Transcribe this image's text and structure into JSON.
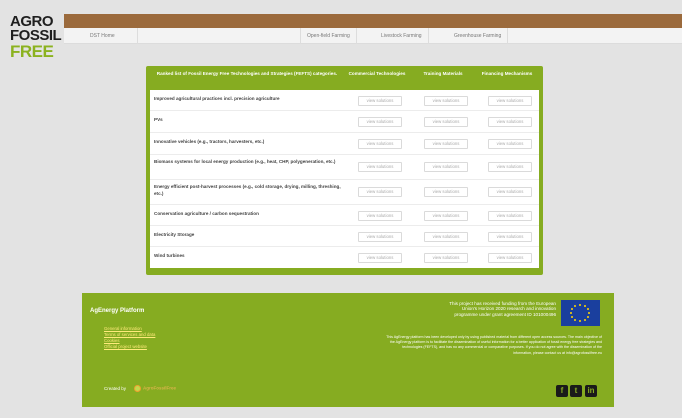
{
  "logo": {
    "line1": "AGRO",
    "line2": "FOSSIL",
    "line3": "FREE"
  },
  "nav": {
    "home": "DST Home",
    "items": [
      "Open-field Farming",
      "Livestock Farming",
      "Greenhouse Farming"
    ]
  },
  "table": {
    "headers": {
      "name": "Ranked list of Fossil Energy Free Technologies and Strategies (FEFTS) categories.",
      "col1": "Commercial Technologies",
      "col2": "Training Materials",
      "col3": "Financing Mechanisms"
    },
    "button_label": "view solutions",
    "rows": [
      "Improved agricultural practices incl. precision agriculture",
      "PVs",
      "Innovative vehicles (e.g., tractors, harvesters, etc.)",
      "Biomass systems for local energy production (e.g., heat, CHP, polygeneration, etc.)",
      "Energy efficient post-harvest processes (e.g., cold storage, drying, milling, threshing, etc.)",
      "Conservation agriculture / carbon sequestration",
      "Electricity Storage",
      "Wind turbines"
    ]
  },
  "footer": {
    "title": "AgEnergy Platform",
    "links": [
      "General information",
      "Terms of services and data",
      "Cookies",
      "Official project website"
    ],
    "created_by": "Created by",
    "created_logo": "AgroFossilFree",
    "funding": "This project has received funding from the European Union's Horizon 2020 research and innovation programme under grant agreement ID 101000496",
    "disclaimer": "This AgEnergy platform has been developed only by using published material from different open access sources. The main objective of the AgEnergy platform is to facilitate the dissemination of useful information for a better application of fossil energy free strategies and technologies (FEFTS), and has no any commercial or comparative purposes. If you do not agree with the dissemination of the information, please contact us at info@agrofossilfree.eu",
    "social": [
      "f",
      "t",
      "in"
    ]
  },
  "colors": {
    "brand_green": "#86ac21",
    "brand_brown": "#9b6a3c"
  }
}
